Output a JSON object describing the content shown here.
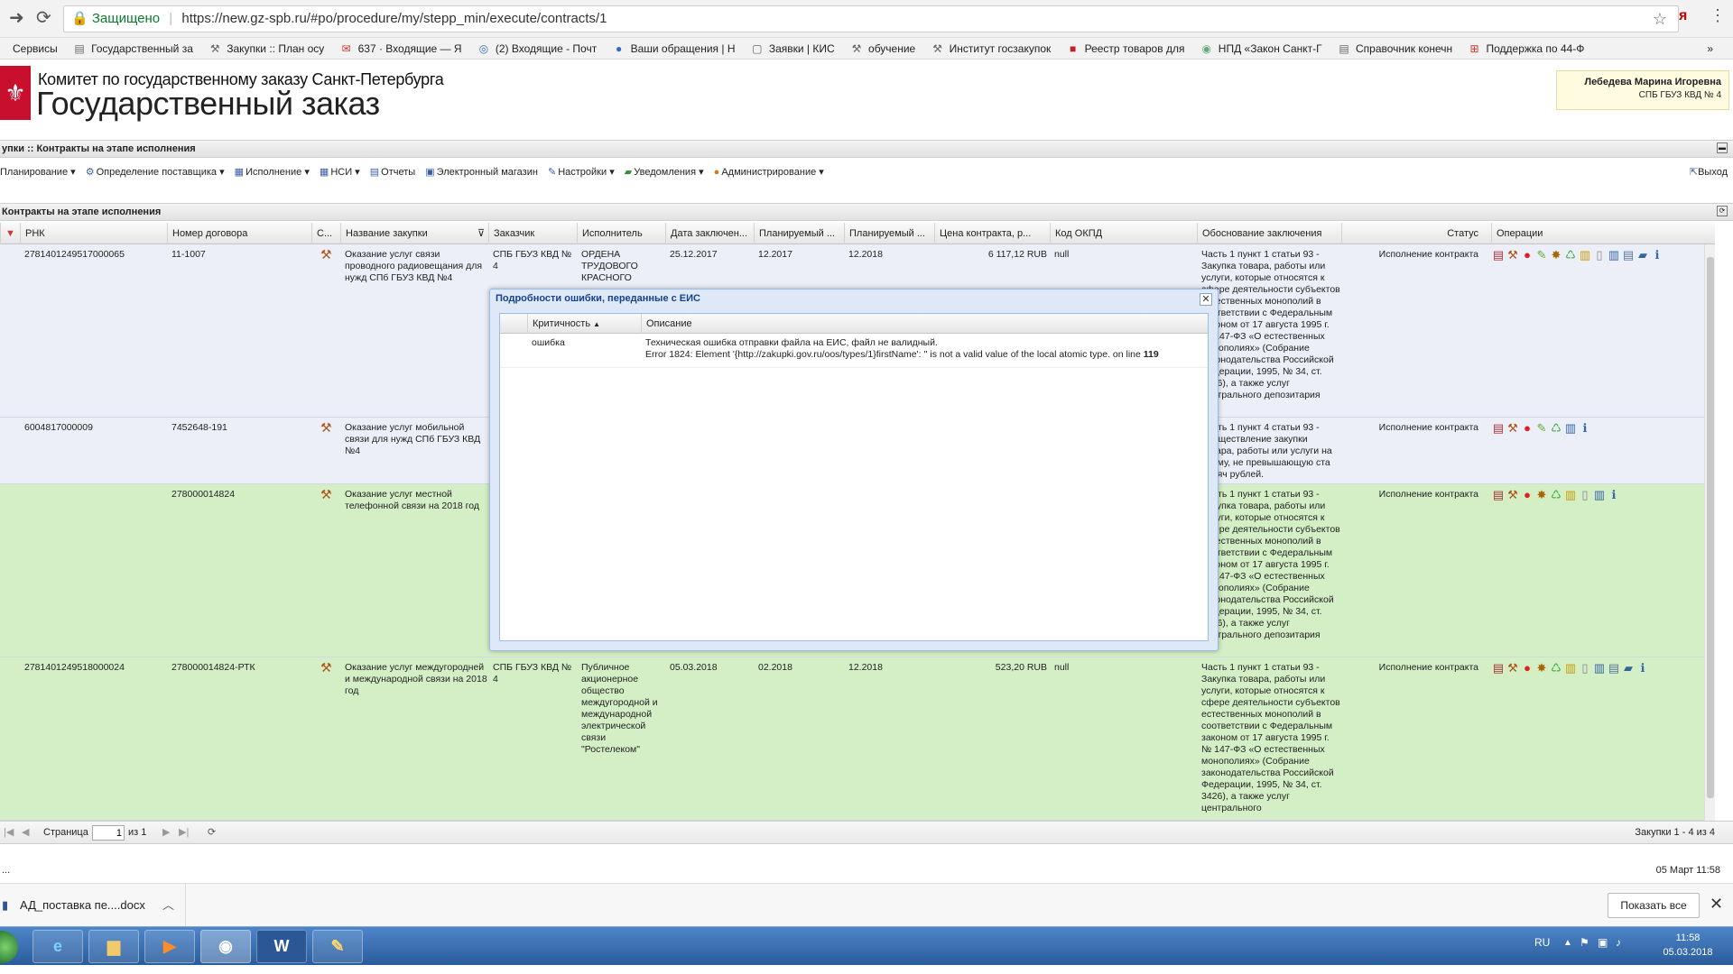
{
  "browser": {
    "secure_label": "Защищено",
    "url": "https://new.gz-spb.ru/#po/procedure/my/stepp_min/execute/contracts/1",
    "bookmarks": [
      "Сервисы",
      "Государственный за",
      "Закупки :: План осу",
      "637 · Входящие — Я",
      "(2) Входящие - Почт",
      "Ваши обращения | Н",
      "Заявки | КИС",
      "обучение",
      "Институт госзакупок",
      "Реестр товаров для",
      "НПД «Закон Санкт-Г",
      "Справочник конечн",
      "Поддержка по 44-Ф"
    ]
  },
  "header": {
    "org": "Комитет по государственному заказу Санкт-Петербурга",
    "app": "Государственный заказ",
    "user_name": "Лебедева Марина Игоревна",
    "user_org": "СПБ ГБУЗ КВД № 4"
  },
  "breadcrumb": "упки :: Контракты на этапе исполнения",
  "toolbar": {
    "items": [
      "Планирование",
      "Определение поставщика",
      "Исполнение",
      "НСИ",
      "Отчеты",
      "Электронный магазин",
      "Настройки",
      "Уведомления",
      "Администрирование"
    ],
    "logout": "Выход"
  },
  "grid": {
    "title": "Контракты на этапе исполнения",
    "columns": [
      "РНК",
      "Номер договора",
      "С...",
      "Название закупки",
      "Заказчик",
      "Исполнитель",
      "Дата заключен...",
      "Планируемый ...",
      "Планируемый ...",
      "Цена контракта, р...",
      "Код ОКПД",
      "Обоснование заключения",
      "Статус",
      "Операции"
    ],
    "rows": [
      {
        "rnk": "2781401249517000065",
        "num": "11-1007",
        "name": "Оказание услуг связи проводного радиовещания для нужд СПб ГБУЗ КВД №4",
        "customer": "СПБ ГБУЗ КВД № 4",
        "executor": "ОРДЕНА ТРУДОВОГО КРАСНОГО ЗНАМЕНИ",
        "date": "25.12.2017",
        "plan1": "12.2017",
        "plan2": "12.2018",
        "price": "6 117,12 RUB",
        "okpd": "null",
        "basis": "Часть 1 пункт 1 статьи 93 - Закупка товара, работы или услуги, которые относятся к сфере деятельности субъектов естественных монополий в соответствии с Федеральным законом от 17 августа 1995 г. № 147-ФЗ «О естественных монополиях» (Собрание законодательства Российской Федерации, 1995, № 34, ст. 3426), а также услуг центрального депозитария",
        "status": "Исполнение контракта"
      },
      {
        "rnk": "6004817000009",
        "num": "7452648-191",
        "name": "Оказание услуг мобильной связи для нужд СПб ГБУЗ КВД №4",
        "customer": "",
        "executor": "",
        "date": "",
        "plan1": "",
        "plan2": "",
        "price": "",
        "okpd": "",
        "basis": "Часть 1 пункт 4 статьи 93 - Осуществление закупки товара, работы или услуги на сумму, не превышающую ста тысяч рублей.",
        "status": "Исполнение контракта"
      },
      {
        "rnk": "",
        "num": "278000014824",
        "name": "Оказание услуг местной телефонной связи на 2018 год",
        "customer": "",
        "executor": "",
        "date": "",
        "plan1": "",
        "plan2": "",
        "price": "",
        "okpd": "",
        "basis": "Часть 1 пункт 1 статьи 93 - Закупка товара, работы или услуги, которые относятся к сфере деятельности субъектов естественных монополий в соответствии с Федеральным законом от 17 августа 1995 г. № 147-ФЗ «О естественных монополиях» (Собрание законодательства Российской Федерации, 1995, № 34, ст. 3426), а также услуг центрального депозитария",
        "status": "Исполнение контракта"
      },
      {
        "rnk": "2781401249518000024",
        "num": "278000014824-РТК",
        "name": "Оказание услуг междугородней и международной связи на 2018 год",
        "customer": "СПБ ГБУЗ КВД № 4",
        "executor": "Публичное акционерное общество междугородной и международной электрической связи \"Ростелеком\"",
        "date": "05.03.2018",
        "plan1": "02.2018",
        "plan2": "12.2018",
        "price": "523,20 RUB",
        "okpd": "null",
        "basis": "Часть 1 пункт 1 статьи 93 - Закупка товара, работы или услуги, которые относятся к сфере деятельности субъектов естественных монополий в соответствии с Федеральным законом от 17 августа 1995 г. № 147-ФЗ «О естественных монополиях» (Собрание законодательства Российской Федерации, 1995, № 34, ст. 3426), а также услуг центрального",
        "status": "Исполнение контракта"
      }
    ]
  },
  "pager": {
    "page_label": "Страница",
    "page_value": "1",
    "of_label": "из 1",
    "summary": "Закупки 1 - 4 из 4"
  },
  "status_date": "05 Март 11:58",
  "status_dots": "...",
  "dialog": {
    "title": "Подробности ошибки, переданные с ЕИС",
    "col_severity": "Критичность",
    "col_desc": "Описание",
    "severity": "ошибка",
    "desc_line1": "Техническая ошибка отправки файла на ЕИС, файл не валидный.",
    "desc_line2": "Error 1824: Element '{http://zakupki.gov.ru/oos/types/1}firstName': '' is not a valid value of the local atomic type. on line ",
    "desc_line_num": "119"
  },
  "downloads": {
    "file": "АД_поставка пе....docx",
    "show_all": "Показать все"
  },
  "taskbar": {
    "lang": "RU",
    "time": "11:58",
    "date": "05.03.2018"
  },
  "colors": {
    "row_blue": "#eceff8",
    "row_green": "#d4efc6",
    "accent": "#15428b"
  }
}
